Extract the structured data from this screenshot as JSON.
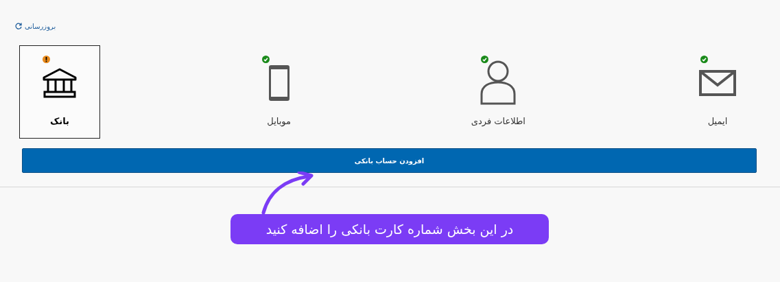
{
  "refresh_link": {
    "label": "بروزرسانی"
  },
  "steps": [
    {
      "label": "ایمیل",
      "kind": "email",
      "verified": true,
      "selected": false
    },
    {
      "label": "اطلاعات فردی",
      "kind": "person",
      "verified": true,
      "selected": false
    },
    {
      "label": "موبایل",
      "kind": "mobile",
      "verified": true,
      "selected": false
    },
    {
      "label": "بانک",
      "kind": "bank",
      "verified": false,
      "selected": true
    }
  ],
  "add_button": {
    "label": "افزودن حساب بانکی"
  },
  "callout": {
    "text": "در این بخش شماره کارت بانکی را اضافه کنید"
  }
}
